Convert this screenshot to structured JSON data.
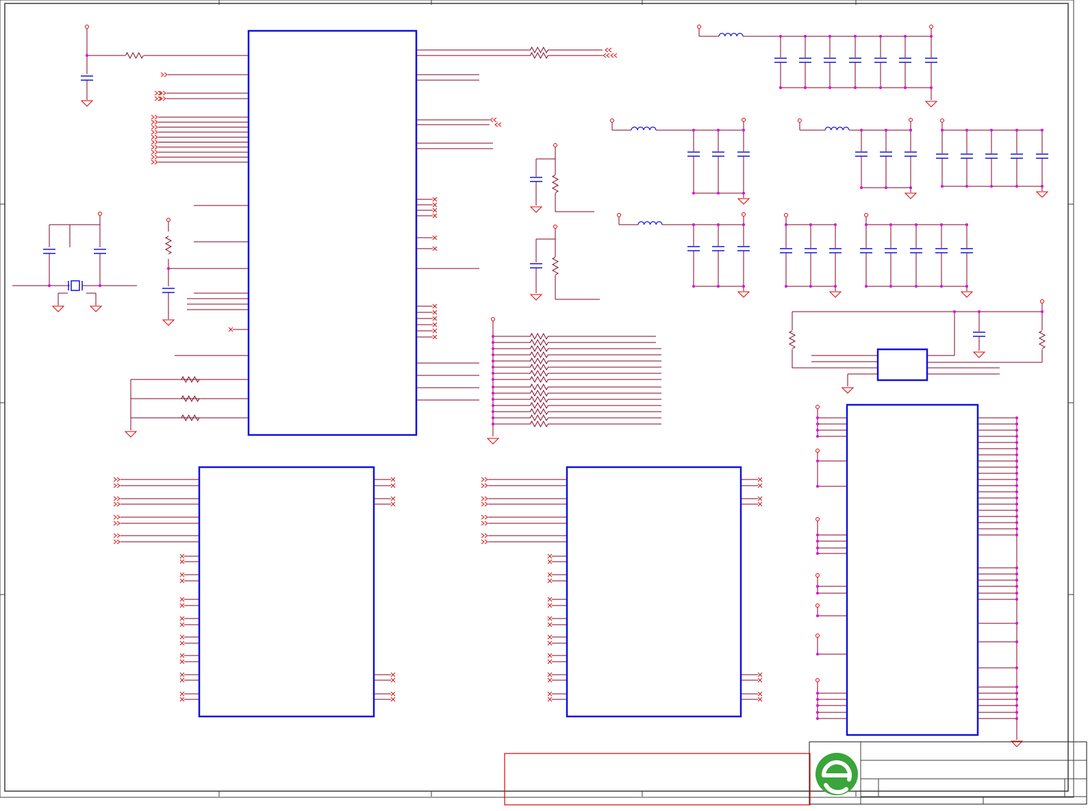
{
  "sheet": {
    "background": "#ffffff",
    "colors": {
      "frame": "#3a3a3a",
      "wire": "#e00000",
      "net": "#800020",
      "component_body": "#1010e0",
      "inductor": "#1010e0",
      "capacitor": "#1010e0",
      "resistor": "#d02040",
      "junction": "#e000e0",
      "no_connect": "#d01010",
      "notes_box": "#e00000",
      "logo_green": "#3aa53a"
    }
  },
  "title_block": {
    "logo": "green-circle-e-logo",
    "title": "",
    "size": "",
    "document_number": "",
    "rev": "",
    "date": "",
    "sheet": ""
  },
  "notes_box": {
    "text": ""
  },
  "components": {
    "main_ic": "main-processor-block",
    "memory_left": "memory-chip-left",
    "memory_right": "memory-chip-right",
    "connector": "connector-block",
    "regulator": "voltage-regulator-block",
    "crystal": "crystal-oscillator"
  }
}
